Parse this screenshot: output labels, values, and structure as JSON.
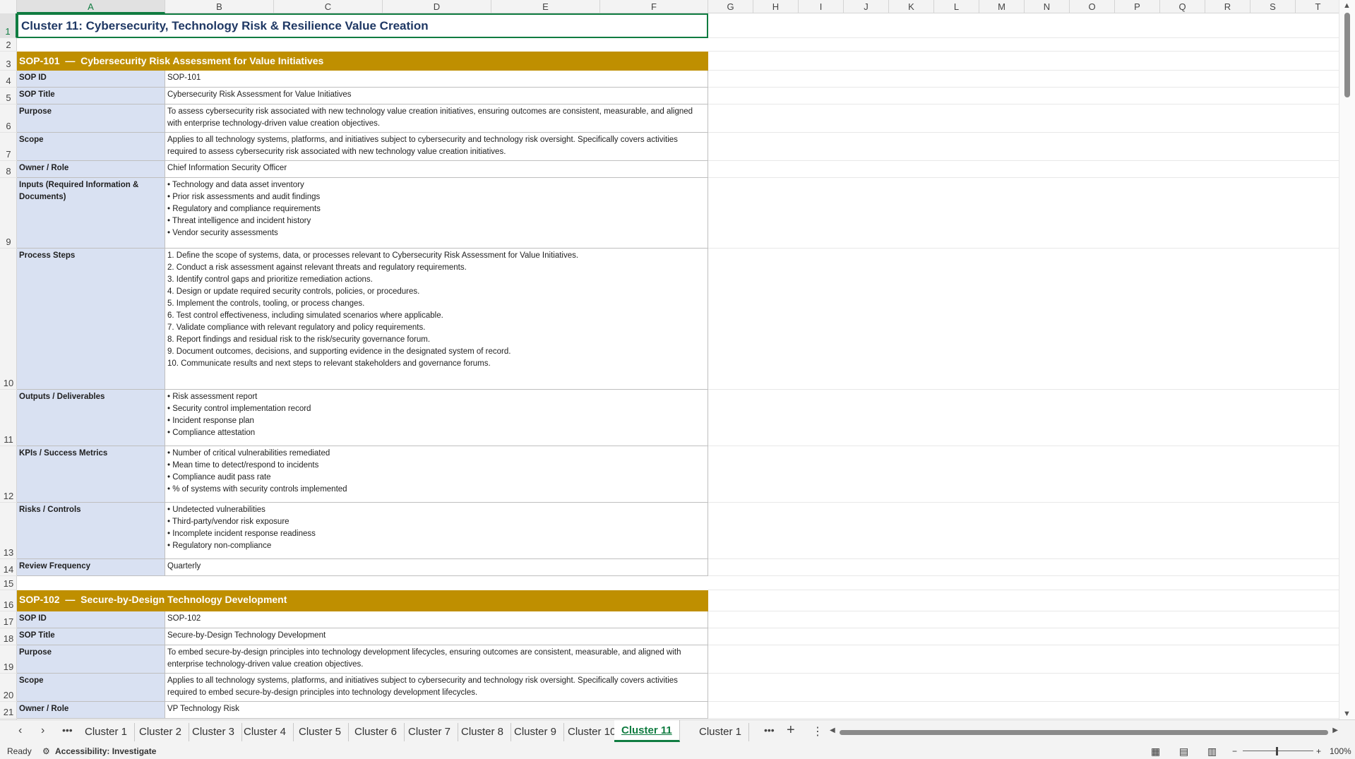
{
  "columns": [
    "A",
    "B",
    "C",
    "D",
    "E",
    "F",
    "G",
    "H",
    "I",
    "J",
    "K",
    "L",
    "M",
    "N",
    "O",
    "P",
    "Q",
    "R",
    "S",
    "T"
  ],
  "title": "Cluster 11: Cybersecurity, Technology Risk & Resilience Value Creation",
  "sops": [
    {
      "header": "SOP-101  —  Cybersecurity Risk Assessment for Value Initiatives",
      "rows": [
        {
          "label": "SOP ID",
          "value": "SOP-101"
        },
        {
          "label": "SOP Title",
          "value": "Cybersecurity Risk Assessment for Value Initiatives"
        },
        {
          "label": "Purpose",
          "value": "To assess cybersecurity risk associated with new technology value creation initiatives, ensuring outcomes are consistent, measurable, and aligned with enterprise technology-driven value creation objectives."
        },
        {
          "label": "Scope",
          "value": "Applies to all technology systems, platforms, and initiatives subject to cybersecurity and technology risk oversight. Specifically covers activities required to assess cybersecurity risk associated with new technology value creation initiatives."
        },
        {
          "label": "Owner / Role",
          "value": "Chief Information Security Officer"
        },
        {
          "label": "Inputs (Required Information & Documents)",
          "value": "• Technology and data asset inventory\n• Prior risk assessments and audit findings\n• Regulatory and compliance requirements\n• Threat intelligence and incident history\n• Vendor security assessments"
        },
        {
          "label": "Process Steps",
          "value": "1. Define the scope of systems, data, or processes relevant to Cybersecurity Risk Assessment for Value Initiatives.\n2. Conduct a risk assessment against relevant threats and regulatory requirements.\n3. Identify control gaps and prioritize remediation actions.\n4. Design or update required security controls, policies, or procedures.\n5. Implement the controls, tooling, or process changes.\n6. Test control effectiveness, including simulated scenarios where applicable.\n7. Validate compliance with relevant regulatory and policy requirements.\n8. Report findings and residual risk to the risk/security governance forum.\n9. Document outcomes, decisions, and supporting evidence in the designated system of record.\n10. Communicate results and next steps to relevant stakeholders and governance forums."
        },
        {
          "label": "Outputs / Deliverables",
          "value": "• Risk assessment report\n• Security control implementation record\n• Incident response plan\n• Compliance attestation"
        },
        {
          "label": "KPIs / Success Metrics",
          "value": "• Number of critical vulnerabilities remediated\n• Mean time to detect/respond to incidents\n• Compliance audit pass rate\n• % of systems with security controls implemented"
        },
        {
          "label": "Risks / Controls",
          "value": "• Undetected vulnerabilities\n• Third-party/vendor risk exposure\n• Incomplete incident response readiness\n• Regulatory non-compliance"
        },
        {
          "label": "Review Frequency",
          "value": "Quarterly"
        }
      ]
    },
    {
      "header": "SOP-102  —  Secure-by-Design Technology Development",
      "rows": [
        {
          "label": "SOP ID",
          "value": "SOP-102"
        },
        {
          "label": "SOP Title",
          "value": "Secure-by-Design Technology Development"
        },
        {
          "label": "Purpose",
          "value": "To embed secure-by-design principles into technology development lifecycles, ensuring outcomes are consistent, measurable, and aligned with enterprise technology-driven value creation objectives."
        },
        {
          "label": "Scope",
          "value": "Applies to all technology systems, platforms, and initiatives subject to cybersecurity and technology risk oversight. Specifically covers activities required to embed secure-by-design principles into technology development lifecycles."
        },
        {
          "label": "Owner / Role",
          "value": "VP Technology Risk"
        }
      ]
    }
  ],
  "tabs": [
    "Cluster 1",
    "Cluster 2",
    "Cluster 3",
    "Cluster 4",
    "Cluster 5",
    "Cluster 6",
    "Cluster 7",
    "Cluster 8",
    "Cluster 9",
    "Cluster 10",
    "Cluster 11",
    "Cluster 1"
  ],
  "active_tab": "Cluster 11",
  "status": {
    "ready": "Ready",
    "accessibility": "Accessibility: Investigate",
    "zoom": "100%"
  },
  "colors": {
    "header_fill": "#bf8f00",
    "label_fill": "#d9e1f2",
    "title_text": "#1f3864",
    "accent": "#107c41"
  }
}
